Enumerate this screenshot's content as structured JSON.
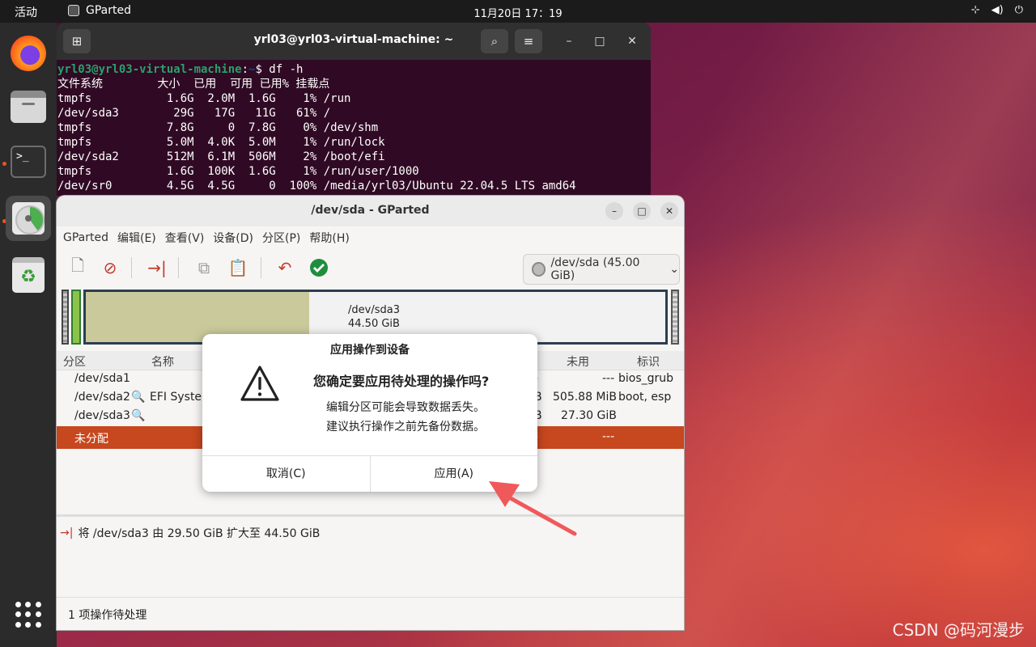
{
  "topbar": {
    "activities": "活动",
    "app_name": "GParted",
    "clock": "11月20日  17：19"
  },
  "terminal": {
    "title": "yrl03@yrl03-virtual-machine: ~",
    "prompt_user": "yrl03@yrl03-virtual-machine",
    "prompt_path": "~",
    "command": "$ df -h",
    "lines": [
      "文件系统        大小  已用  可用 已用% 挂载点",
      "tmpfs           1.6G  2.0M  1.6G    1% /run",
      "/dev/sda3        29G   17G   11G   61% /",
      "tmpfs           7.8G     0  7.8G    0% /dev/shm",
      "tmpfs           5.0M  4.0K  5.0M    1% /run/lock",
      "/dev/sda2       512M  6.1M  506M    2% /boot/efi",
      "tmpfs           1.6G  100K  1.6G    1% /run/user/1000",
      "/dev/sr0        4.5G  4.5G     0  100% /media/yrl03/Ubuntu 22.04.5 LTS amd64"
    ]
  },
  "gparted": {
    "title": "/dev/sda - GParted",
    "menu": [
      "GParted",
      "编辑(E)",
      "查看(V)",
      "设备(D)",
      "分区(P)",
      "帮助(H)"
    ],
    "device_selector": "/dev/sda (45.00 GiB)",
    "map_label_name": "/dev/sda3",
    "map_label_size": "44.50 GiB",
    "headers": {
      "partition": "分区",
      "name": "名称",
      "used": "未用",
      "flags": "标识"
    },
    "rows": [
      {
        "partition": "/dev/sda1",
        "name": "",
        "used": "---",
        "flags": "bios_grub"
      },
      {
        "partition": "/dev/sda2",
        "name": "EFI System",
        "used_suffix": "B",
        "used": "505.88 MiB",
        "flags": "boot, esp"
      },
      {
        "partition": "/dev/sda3",
        "name": "",
        "used_suffix": "B",
        "used": "27.30 GiB",
        "flags": ""
      },
      {
        "partition": "未分配",
        "name": "",
        "used": "---",
        "flags": ""
      }
    ],
    "pending_op": "将 /dev/sda3 由 29.50 GiB 扩大至 44.50 GiB",
    "status": "1 项操作待处理"
  },
  "dialog": {
    "title": "应用操作到设备",
    "question": "您确定要应用待处理的操作吗?",
    "message_line1": "编辑分区可能会导致数据丢失。",
    "message_line2": "建议执行操作之前先备份数据。",
    "cancel_label": "取消(C)",
    "apply_label": "应用(A)"
  },
  "watermark": "CSDN @码河漫步",
  "colors": {
    "accent": "#e95420",
    "selected_row": "#c7471f",
    "annotation_arrow": "#f0595a"
  }
}
